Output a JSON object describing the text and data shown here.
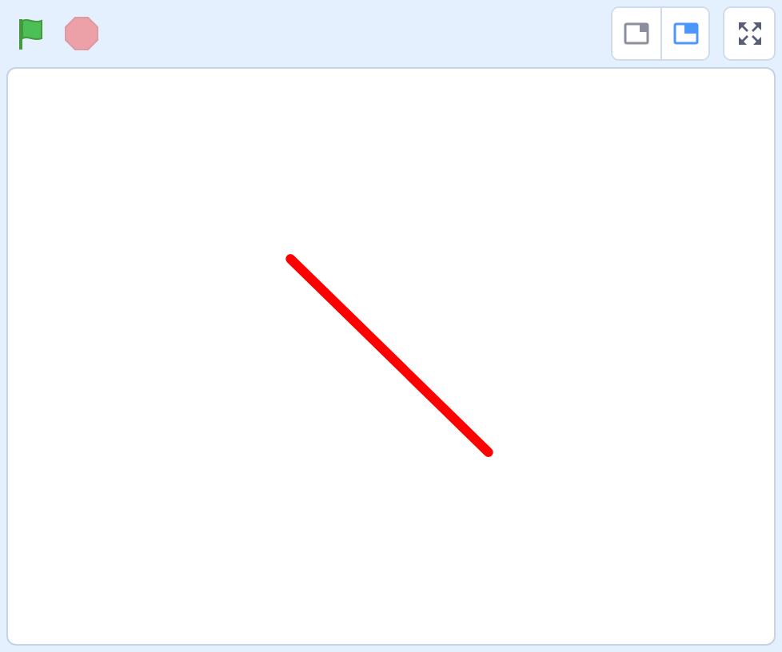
{
  "controls": {
    "running": false
  },
  "stage_modes": [
    {
      "kind": "small",
      "selected": false
    },
    {
      "kind": "normal",
      "selected": true
    }
  ],
  "stage": {
    "drawings": [
      {
        "kind": "pen-line"
      }
    ]
  }
}
